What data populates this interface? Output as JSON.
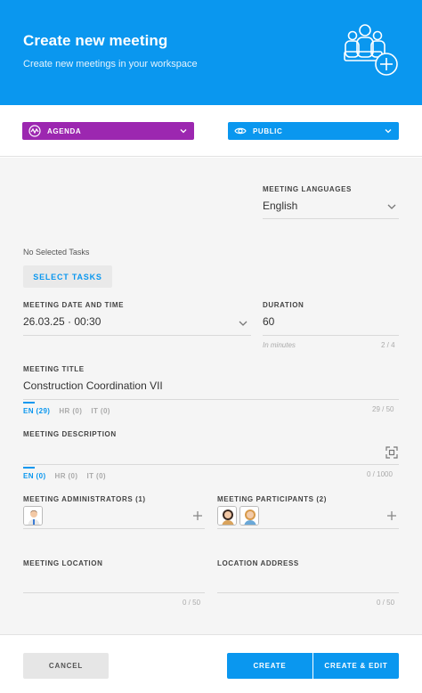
{
  "header": {
    "title": "Create new meeting",
    "subtitle": "Create new meetings in your workspace",
    "icon": "add-people-icon"
  },
  "selectors": {
    "type": {
      "label": "AGENDA",
      "icon": "agenda-icon",
      "color": "#9c27b0"
    },
    "visibility": {
      "label": "PUBLIC",
      "icon": "eye-icon",
      "color": "#0a97ef"
    }
  },
  "languages": {
    "label": "MEETING LANGUAGES",
    "value": "English"
  },
  "tasks": {
    "status": "No Selected Tasks",
    "button": "SELECT TASKS"
  },
  "datetime": {
    "label": "MEETING DATE AND TIME",
    "value": "26.03.25 · 00:30"
  },
  "duration": {
    "label": "DURATION",
    "value": "60",
    "hint": "In minutes",
    "counter": "2 / 4"
  },
  "meeting_title": {
    "label": "MEETING TITLE",
    "value": "Construction Coordination VII",
    "counter": "29 / 50",
    "tabs": [
      "EN (29)",
      "HR (0)",
      "IT (0)"
    ]
  },
  "description": {
    "label": "MEETING DESCRIPTION",
    "counter": "0 / 1000",
    "tabs": [
      "EN (0)",
      "HR (0)",
      "IT (0)"
    ]
  },
  "administrators": {
    "label": "MEETING ADMINISTRATORS (1)"
  },
  "participants": {
    "label": "MEETING PARTICIPANTS (2)"
  },
  "location": {
    "label": "MEETING LOCATION",
    "counter": "0 / 50"
  },
  "address": {
    "label": "LOCATION ADDRESS",
    "counter": "0 / 50"
  },
  "footer": {
    "cancel": "CANCEL",
    "create": "CREATE",
    "create_edit": "CREATE & EDIT"
  },
  "colors": {
    "accent": "#0a97ef",
    "agenda": "#9c27b0"
  }
}
